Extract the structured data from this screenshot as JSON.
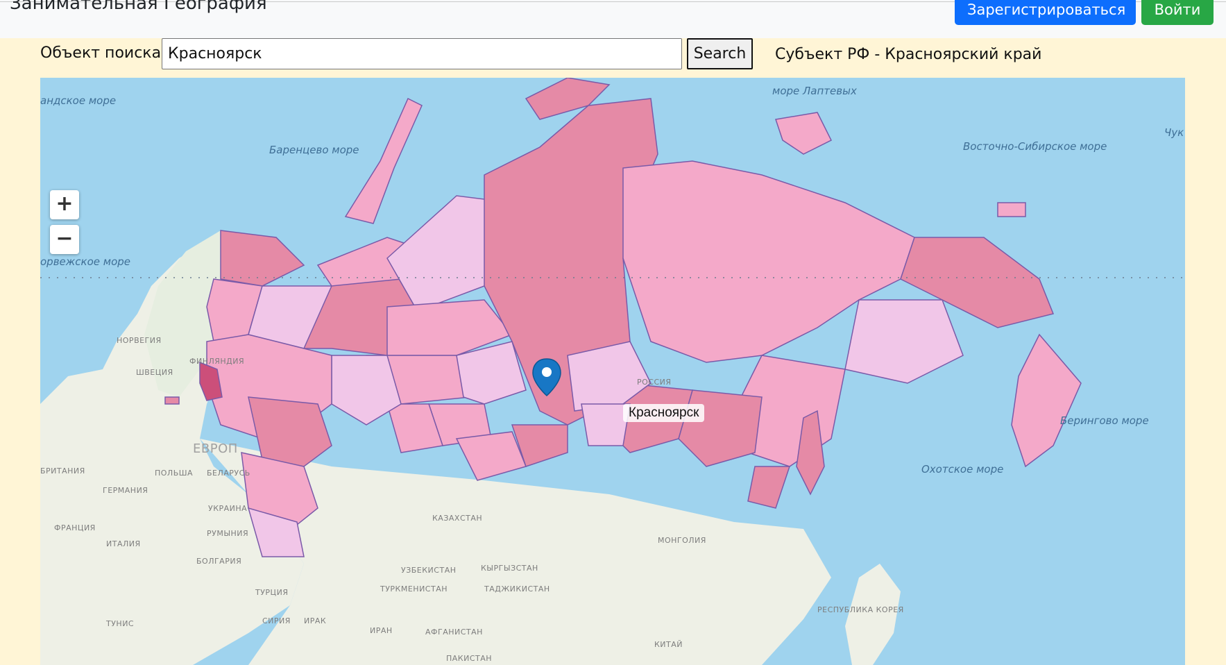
{
  "header": {
    "brand": "Занимательная География",
    "register_label": "Зарегистрироваться",
    "login_label": "Войти"
  },
  "search": {
    "label": "Объект поиска:",
    "value": "Красноярск",
    "button_label": "Search",
    "result": "Субъект РФ - Красноярский край"
  },
  "map": {
    "zoom_in": "+",
    "zoom_out": "−",
    "marker_label": "Красноярск",
    "labels": {
      "greenland_sea": "андское море",
      "barents_sea": "Баренцево море",
      "laptev_sea": "море Лаптевых",
      "east_siberian_sea": "Восточно-Сибирское море",
      "chukchi": "Чук",
      "norwegian_sea": "орвежское море",
      "bering_sea": "Берингово море",
      "okhotsk_sea": "Охотское море",
      "norway": "НОРВЕГИЯ",
      "finland": "ФИНЛЯНДИЯ",
      "sweden": "ШВЕЦИЯ",
      "europe": "ЕВРОП",
      "poland": "ПОЛЬША",
      "belarus": "БЕЛАРУСЬ",
      "germany": "ГЕРМАНИЯ",
      "ukraine": "УКРАИНА",
      "france": "ФРАНЦИЯ",
      "italy": "ИТАЛИЯ",
      "romania": "РУМЫНИЯ",
      "bulgaria": "БОЛГАРИЯ",
      "turkey": "ТУРЦИЯ",
      "kazakhstan": "КАЗАХСТАН",
      "uzbekistan": "УЗБЕКИСТАН",
      "kyrgyzstan": "КЫРГЫЗСТАН",
      "turkmenistan": "ТУРКМЕНИСТАН",
      "tajikistan": "ТАДЖИКИСТАН",
      "mongolia": "МОНГОЛИЯ",
      "iran": "ИРАН",
      "iraq": "ИРАК",
      "afghanistan": "АФГАНИСТАН",
      "pakistan": "ПАКИСТАН",
      "china": "КИТАЙ",
      "korea": "РЕСПУБЛИКА КОРЕЯ",
      "tunisia": "ТУНИС",
      "syria": "СИРИЯ",
      "russia": "РОССИЯ",
      "britain": "БРИТАНИЯ"
    },
    "colors": {
      "water": "#9fd3ee",
      "land": "#eef0e6",
      "region_light": "#f1c6e8",
      "region_mid": "#f4a9c9",
      "region_dark": "#e58aa6",
      "region_border": "#7a5aa8",
      "highlight": "#cc4f7a"
    }
  }
}
